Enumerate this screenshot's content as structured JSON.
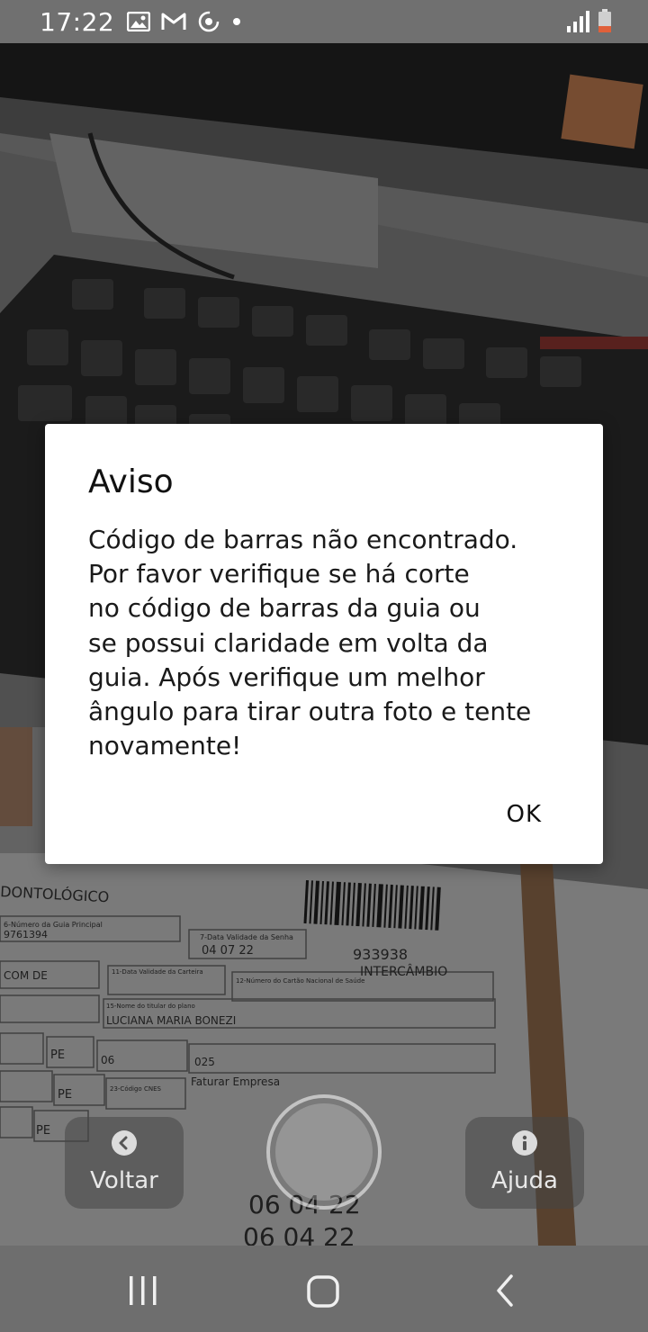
{
  "status_bar": {
    "time": "17:22",
    "left_icons": [
      "gallery-icon",
      "gmail-icon",
      "sync-icon",
      "dot-icon"
    ],
    "right_icons": [
      "signal-icon",
      "battery-low-icon"
    ]
  },
  "background_document": {
    "header": "DONTOLÓGICO",
    "field_guide_number_label": "6-Número da Guia Principal",
    "guide_number": "9761394",
    "validity_label": "7-Data Validade da Senha",
    "validity_date": "04 07 22",
    "barcode_number": "933938",
    "intercambio": "INTERCÂMBIO",
    "com_de": "COM DE",
    "card_validity_label": "11-Data Validade da Carteira",
    "cns_label": "12-Número do Cartão Nacional de Saúde",
    "plan_holder_label": "15-Nome do titular do plano",
    "plan_holder": "LUCIANA MARIA BONEZI",
    "uf_1": "PE",
    "cbo_1": "06",
    "code_025": "025",
    "faturar": "Faturar Empresa",
    "uf_2": "PE",
    "cnes_label": "23-Código CNES",
    "uf_3": "PE",
    "date_1": "06 04 22",
    "date_2": "06 04 22"
  },
  "camera_controls": {
    "back_label": "Voltar",
    "help_label": "Ajuda"
  },
  "dialog": {
    "title": "Aviso",
    "message_lines": [
      "Código de barras não encontrado.",
      "Por favor verifique se há corte",
      "no código de barras da guia ou",
      "se possui claridade em volta da",
      "guia. Após verifique um melhor",
      "ângulo para tirar outra foto e tente",
      "novamente!"
    ],
    "ok_label": "OK"
  },
  "colors": {
    "dialog_bg": "#ffffff",
    "status_bar_bg": "#707070",
    "nav_bar_bg": "#6e6e6e",
    "battery_low": "#e0603a"
  }
}
